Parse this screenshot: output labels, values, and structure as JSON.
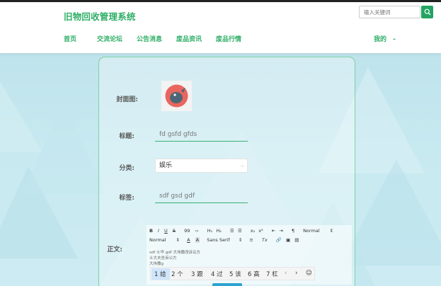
{
  "header": {
    "brand": "旧物回收管理系统",
    "search_placeholder": "输入关键词",
    "nav": [
      "首页",
      "交流论坛",
      "公告消息",
      "废品资讯",
      "废品行情"
    ],
    "user_menu": "我的",
    "user_menu_caret": "-"
  },
  "form": {
    "cover_label": "封面图:",
    "title_label": "标题:",
    "title_value": "fd gsfd gfds",
    "category_label": "分类:",
    "category_value": "娱乐",
    "tags_label": "标签:",
    "tags_value": "sdf gsd gdf",
    "body_label": "正文:"
  },
  "editor": {
    "toolbar_row1": [
      "B",
      "I",
      "U",
      "S",
      "99",
      "‹›",
      "H₁",
      "H₂",
      "☰",
      "☰",
      "x₂",
      "x²",
      "⇤",
      "⇥",
      "¶",
      "Normal",
      "⇕"
    ],
    "toolbar_row2": [
      "Normal",
      "⇕",
      "A",
      "A",
      "Sans Serif",
      "⇕",
      "≡",
      "Tx",
      "🔗",
      "▣",
      "▤"
    ],
    "lines": [
      "sdf 士华 gdf 大伟撒改诉讼方",
      "士大夫告诉公方",
      "大伟撒g"
    ]
  },
  "ime": {
    "candidates": [
      "1 给",
      "2 个",
      "3 跟",
      "4 过",
      "5 该",
      "6 高",
      "7 杠"
    ],
    "nav_prev": "‹",
    "nav_next": "›",
    "emoji": "☺"
  },
  "colors": {
    "brand": "#2eae66",
    "accent_border": "#7fd1a3",
    "background": "#c7e9f0"
  }
}
